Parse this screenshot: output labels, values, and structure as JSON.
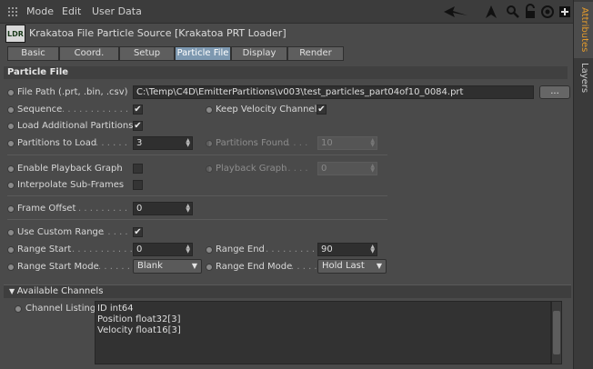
{
  "menubar": {
    "items": [
      "Mode",
      "Edit",
      "User Data"
    ]
  },
  "toolbar_icons": [
    "back-arrow-icon",
    "up-arrow-icon",
    "search-icon",
    "lock-icon",
    "target-icon",
    "add-panel-icon"
  ],
  "header": {
    "logo": "LDR",
    "title": "Krakatoa File Particle Source [Krakatoa PRT Loader]"
  },
  "tabs": [
    "Basic",
    "Coord.",
    "Setup",
    "Particle File",
    "Display",
    "Render"
  ],
  "active_tab": "Particle File",
  "section_title": "Particle File",
  "file_path": {
    "label": "File Path (.prt, .bin, .csv)",
    "value": "C:\\Temp\\C4D\\EmitterPartitions\\v003\\test_particles_part04of10_0084.prt",
    "button": "..."
  },
  "sequence": {
    "label": "Sequence",
    "dots": " . . . . . . . . . . . . .",
    "checked": "✔"
  },
  "keep_velocity": {
    "label": "Keep Velocity Channel",
    "checked": "✔"
  },
  "load_additional": {
    "label": "Load Additional Partitions",
    "checked": "✔"
  },
  "partitions_to_load": {
    "label": "Partitions to Load",
    "dots": " . . . . . .",
    "value": "3"
  },
  "partitions_found": {
    "label": "Partitions Found",
    "dots": " . . . .",
    "value": "10"
  },
  "enable_playback": {
    "label": "Enable Playback Graph",
    "dots": " .",
    "checked": ""
  },
  "playback_graph": {
    "label": "Playback Graph",
    "dots": " . . . . .",
    "value": "0"
  },
  "interpolate": {
    "label": "Interpolate Sub-Frames",
    "checked": ""
  },
  "frame_offset": {
    "label": "Frame Offset",
    "dots": " . . . . . . . . .",
    "value": "0"
  },
  "use_custom_range": {
    "label": "Use Custom Range",
    "dots": " . . . . .",
    "checked": "✔"
  },
  "range_start": {
    "label": "Range Start",
    "dots": " . . . . . . . . . . .",
    "value": "0"
  },
  "range_end": {
    "label": "Range End",
    "dots": " . . . . . . . . .",
    "value": "90"
  },
  "range_start_mode": {
    "label": "Range Start Mode",
    "dots": ". . . . . . .",
    "value": "Blank"
  },
  "range_end_mode": {
    "label": "Range End Mode",
    "dots": ". . . . .",
    "value": "Hold Last"
  },
  "available_channels": {
    "title": "Available Channels",
    "listing_label": "Channel Listing",
    "channels": [
      "ID int64",
      "Position float32[3]",
      "Velocity float16[3]"
    ]
  },
  "sidebar_tabs": [
    "Attributes",
    "Layers"
  ]
}
